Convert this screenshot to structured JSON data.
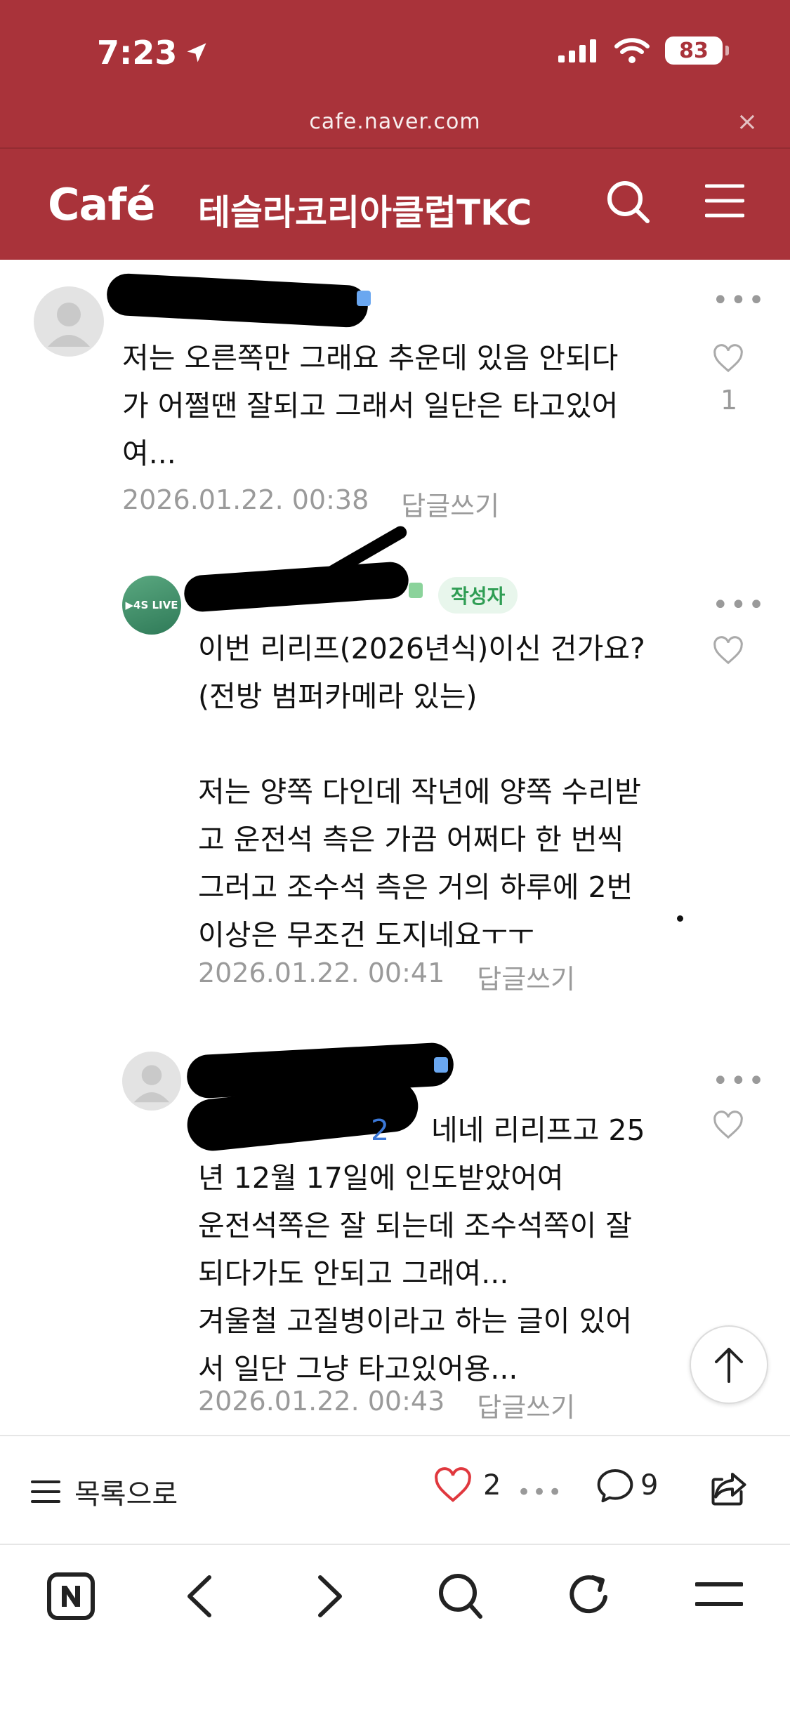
{
  "status_bar": {
    "time": "7:23",
    "battery": "83"
  },
  "browser": {
    "url": "cafe.naver.com",
    "close_glyph": "×"
  },
  "app_bar": {
    "logo": "Café",
    "cafe_name": "테슬라코리아클럽TKC"
  },
  "comments": [
    {
      "text": "저는 오른쪽만 그래요 추운데 있음 안되다\n가 어쩔땐 잘되고 그래서 일단은 타고있어\n여...",
      "date": "2026.01.22. 00:38",
      "reply_label": "답글쓰기",
      "like_count": "1"
    },
    {
      "avatar_text": "▶4S LIVE",
      "author_badge": "작성자",
      "text": "이번 리리프(2026년식)이신 건가요?\n(전방 범퍼카메라 있는)\n\n저는 양쪽 다인데 작년에 양쪽 수리받\n고 운전석 측은 가끔 어쩌다 한 번씩\n그러고 조수석 측은 거의 하루에 2번\n이상은 무조건 도지네요ㅜㅜ",
      "date": "2026.01.22. 00:41",
      "reply_label": "답글쓰기"
    },
    {
      "text_first_line": "네네 리리프고 25",
      "text": "년 12월 17일에 인도받았어여\n운전석쪽은 잘 되는데 조수석쪽이 잘\n되다가도 안되고 그래여...\n겨울철 고질병이라고 하는 글이 있어\n서 일단 그냥 타고있어용...",
      "date": "2026.01.22. 00:43",
      "reply_label": "답글쓰기"
    }
  ],
  "action_bar": {
    "list_label": "목록으로",
    "like_count": "2",
    "comment_count": "9"
  },
  "colors": {
    "brand_red": "#a9333a",
    "author_green": "#2f9d54",
    "heart_red": "#e0383e"
  },
  "icons": [
    "location-arrow-icon",
    "signal-icon",
    "wifi-icon",
    "battery-icon",
    "close-icon",
    "search-icon",
    "hamburger-menu-icon",
    "more-icon",
    "heart-icon",
    "scroll-top-icon",
    "list-icon",
    "comment-icon",
    "share-icon",
    "naver-home-icon",
    "back-icon",
    "forward-icon",
    "refresh-icon"
  ]
}
